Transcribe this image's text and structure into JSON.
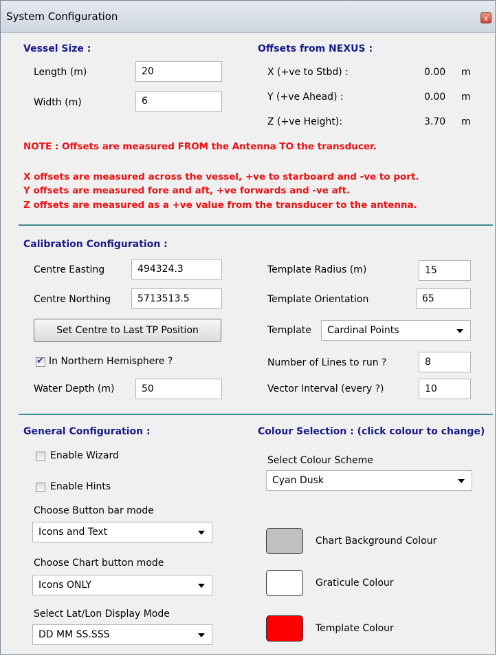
{
  "window": {
    "title": "System Configuration",
    "close_label": "x"
  },
  "vessel": {
    "heading": "Vessel Size :",
    "length_label": "Length (m)",
    "length_value": "20",
    "width_label": "Width (m)",
    "width_value": "6"
  },
  "offsets": {
    "heading": "Offsets from NEXUS :",
    "rows": [
      {
        "label": "X (+ve to Stbd) :",
        "value": "0.00",
        "unit": "m"
      },
      {
        "label": "Y (+ve Ahead) :",
        "value": "0.00",
        "unit": "m"
      },
      {
        "label": "Z (+ve Height):",
        "value": "3.70",
        "unit": "m"
      }
    ]
  },
  "notes": {
    "main": "NOTE : Offsets are measured FROM the Antenna TO the transducer.",
    "x": "X offsets are measured across the vessel, +ve to starboard and -ve to port.",
    "y": "Y offsets are measured fore and aft, +ve forwards and -ve aft.",
    "z": "Z offsets are measured as a +ve value from the transducer to the antenna."
  },
  "calibration": {
    "heading": "Calibration Configuration :",
    "easting_label": "Centre Easting",
    "easting_value": "494324.3",
    "northing_label": "Centre Northing",
    "northing_value": "5713513.5",
    "set_centre_button": "Set Centre to Last TP Position",
    "northern_label": "In Northern Hemisphere ?",
    "northern_checked": true,
    "depth_label": "Water Depth (m)",
    "depth_value": "50",
    "radius_label": "Template Radius (m)",
    "radius_value": "15",
    "orientation_label": "Template Orientation",
    "orientation_value": "65",
    "template_label": "Template",
    "template_value": "Cardinal Points",
    "lines_label": "Number of Lines to run ?",
    "lines_value": "8",
    "vector_label": "Vector Interval (every ?)",
    "vector_value": "10"
  },
  "general": {
    "heading": "General Configuration :",
    "wizard_label": "Enable Wizard",
    "wizard_checked": false,
    "hints_label": "Enable Hints",
    "hints_checked": false,
    "button_bar_label": "Choose Button bar mode",
    "button_bar_value": "Icons and Text",
    "chart_button_label": "Choose Chart button mode",
    "chart_button_value": "Icons ONLY",
    "latlon_label": "Select Lat/Lon Display Mode",
    "latlon_value": "DD MM SS.SSS"
  },
  "colours": {
    "heading": "Colour Selection : (click colour to change)",
    "scheme_label": "Select Colour Scheme",
    "scheme_value": "Cyan Dusk",
    "items": [
      {
        "label": "Chart Background Colour",
        "color": "#c0c0c0"
      },
      {
        "label": "Graticule Colour",
        "color": "#ffffff"
      },
      {
        "label": "Template Colour",
        "color": "#ff0000"
      }
    ]
  },
  "theme": {
    "heading_color": "#1a1a8c",
    "note_color": "#ee1111",
    "divider_color": "#3d8d8d"
  }
}
